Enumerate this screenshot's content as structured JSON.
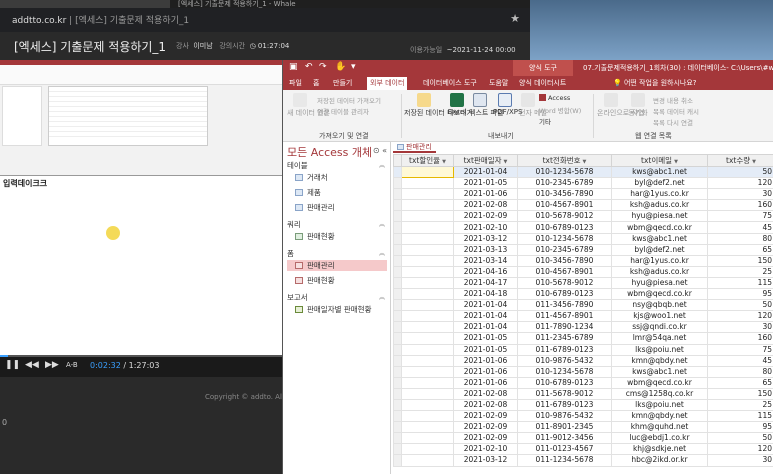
{
  "browser": {
    "tab_title": "[엑세스] 기출문제 적용하기_1 - Whale",
    "url_host": "addtto.co.kr",
    "url_page": "[엑세스] 기출문제 적용하기_1"
  },
  "page_header": {
    "title": "[엑세스] 기출문제 적용하기_1",
    "instructor_label": "강사",
    "instructor_name": "이미남",
    "duration_label": "강의시간",
    "duration_value": "01:27:04",
    "available_label": "이용가능일",
    "available_value": "~2021-11-24 00:00"
  },
  "video": {
    "inner_caption": "입력데이크크",
    "current_time": "0:02:32",
    "separator": "/",
    "total_time": "1:27:03",
    "ab_label": "A-B",
    "progress": 0.03
  },
  "copyright": "Copyright © addto. All",
  "access": {
    "context_tab": "양식 도구",
    "window_title": "07.기출문제적용하기_1회차(30) : 데이터베이스- C:\\Users\\#wi...",
    "tabs": [
      "파일",
      "홈",
      "만들기",
      "외부 데이터",
      "데이터베이스 도구",
      "도움말",
      "양식 데이터시트"
    ],
    "active_tab_index": 3,
    "tell_me": "어떤 작업을 원하시나요?",
    "ribbon": {
      "new_source": "새 데이터 원본",
      "saved_import": "저장된 데이터 가져오기",
      "linked_table_manager": "연결 테이블 관리자",
      "group_import": "가져오기 및 연결",
      "saved_export": "저장된 데이터 내보내기",
      "excel": "Excel",
      "text_file": "텍스트 파일",
      "pdf_xps": "PDF/XPS",
      "email": "전자 메일",
      "access_export": "Access",
      "word_merge": "Word 병합(W)",
      "other": "기타",
      "group_export": "내보내기",
      "online_work": "온라인으로 작업",
      "sync": "동기화",
      "relink_lists": "목록 다시 연결",
      "change_list_data": "변경 내용 취소",
      "cache_data": "목록 데이터 캐시",
      "discard": "목록 다시 연결",
      "group_lists": "웹 연결 목록"
    },
    "nav": {
      "title": "모든 Access 개체",
      "sections": [
        {
          "label": "테이블",
          "items": [
            "거래처",
            "제품",
            "판매관리"
          ]
        },
        {
          "label": "쿼리",
          "items": [
            "판매현황"
          ]
        },
        {
          "label": "폼",
          "items": [
            "판매관리",
            "판매현황"
          ]
        },
        {
          "label": "보고서",
          "items": [
            "판매일자별 판매현황"
          ]
        }
      ],
      "selected_item": "판매관리"
    },
    "doc_tab": "판매관리",
    "columns": [
      "txt할인율",
      "txt판매일자",
      "txt전화번호",
      "txt이메일",
      "txt수량"
    ],
    "rows": [
      [
        "",
        "2021-01-04",
        "010-1234-5678",
        "kws@abc1.net",
        "50"
      ],
      [
        "",
        "2021-01-05",
        "010-2345-6789",
        "byl@def2.net",
        "120"
      ],
      [
        "",
        "2021-01-06",
        "010-3456-7890",
        "har@1yus.co.kr",
        "30"
      ],
      [
        "",
        "2021-02-08",
        "010-4567-8901",
        "ksh@adus.co.kr",
        "160"
      ],
      [
        "",
        "2021-02-09",
        "010-5678-9012",
        "hyu@piesa.net",
        "75"
      ],
      [
        "",
        "2021-02-10",
        "010-6789-0123",
        "wbm@qecd.co.kr",
        "45"
      ],
      [
        "",
        "2021-03-12",
        "010-1234-5678",
        "kws@abc1.net",
        "80"
      ],
      [
        "",
        "2021-03-13",
        "010-2345-6789",
        "byl@def2.net",
        "65"
      ],
      [
        "",
        "2021-03-14",
        "010-3456-7890",
        "har@1yus.co.kr",
        "150"
      ],
      [
        "",
        "2021-04-16",
        "010-4567-8901",
        "ksh@adus.co.kr",
        "25"
      ],
      [
        "",
        "2021-04-17",
        "010-5678-9012",
        "hyu@piesa.net",
        "115"
      ],
      [
        "",
        "2021-04-18",
        "010-6789-0123",
        "wbm@qecd.co.kr",
        "95"
      ],
      [
        "",
        "2021-01-04",
        "011-3456-7890",
        "nsy@qbqb.net",
        "50"
      ],
      [
        "",
        "2021-01-04",
        "011-4567-8901",
        "kjs@woo1.net",
        "120"
      ],
      [
        "",
        "2021-01-04",
        "011-7890-1234",
        "ssj@qndi.co.kr",
        "30"
      ],
      [
        "",
        "2021-01-05",
        "011-2345-6789",
        "lmr@54qa.net",
        "160"
      ],
      [
        "",
        "2021-01-05",
        "011-6789-0123",
        "lks@poiu.net",
        "75"
      ],
      [
        "",
        "2021-01-06",
        "010-9876-5432",
        "kmn@qbdy.net",
        "45"
      ],
      [
        "",
        "2021-01-06",
        "010-1234-5678",
        "kws@abc1.net",
        "80"
      ],
      [
        "",
        "2021-01-06",
        "010-6789-0123",
        "wbm@qecd.co.kr",
        "65"
      ],
      [
        "",
        "2021-02-08",
        "011-5678-9012",
        "cms@1258q.co.kr",
        "150"
      ],
      [
        "",
        "2021-02-08",
        "011-6789-0123",
        "lks@poiu.net",
        "25"
      ],
      [
        "",
        "2021-02-09",
        "010-9876-5432",
        "kmn@qbdy.net",
        "115"
      ],
      [
        "",
        "2021-02-09",
        "011-8901-2345",
        "khm@quhd.net",
        "95"
      ],
      [
        "",
        "2021-02-09",
        "011-9012-3456",
        "luc@ebdj1.co.kr",
        "50"
      ],
      [
        "",
        "2021-02-10",
        "011-0123-4567",
        "khj@sdkje.net",
        "120"
      ],
      [
        "",
        "2021-03-12",
        "011-1234-5678",
        "hbc@2ikd.or.kr",
        "30"
      ]
    ]
  },
  "left_marker": "0"
}
